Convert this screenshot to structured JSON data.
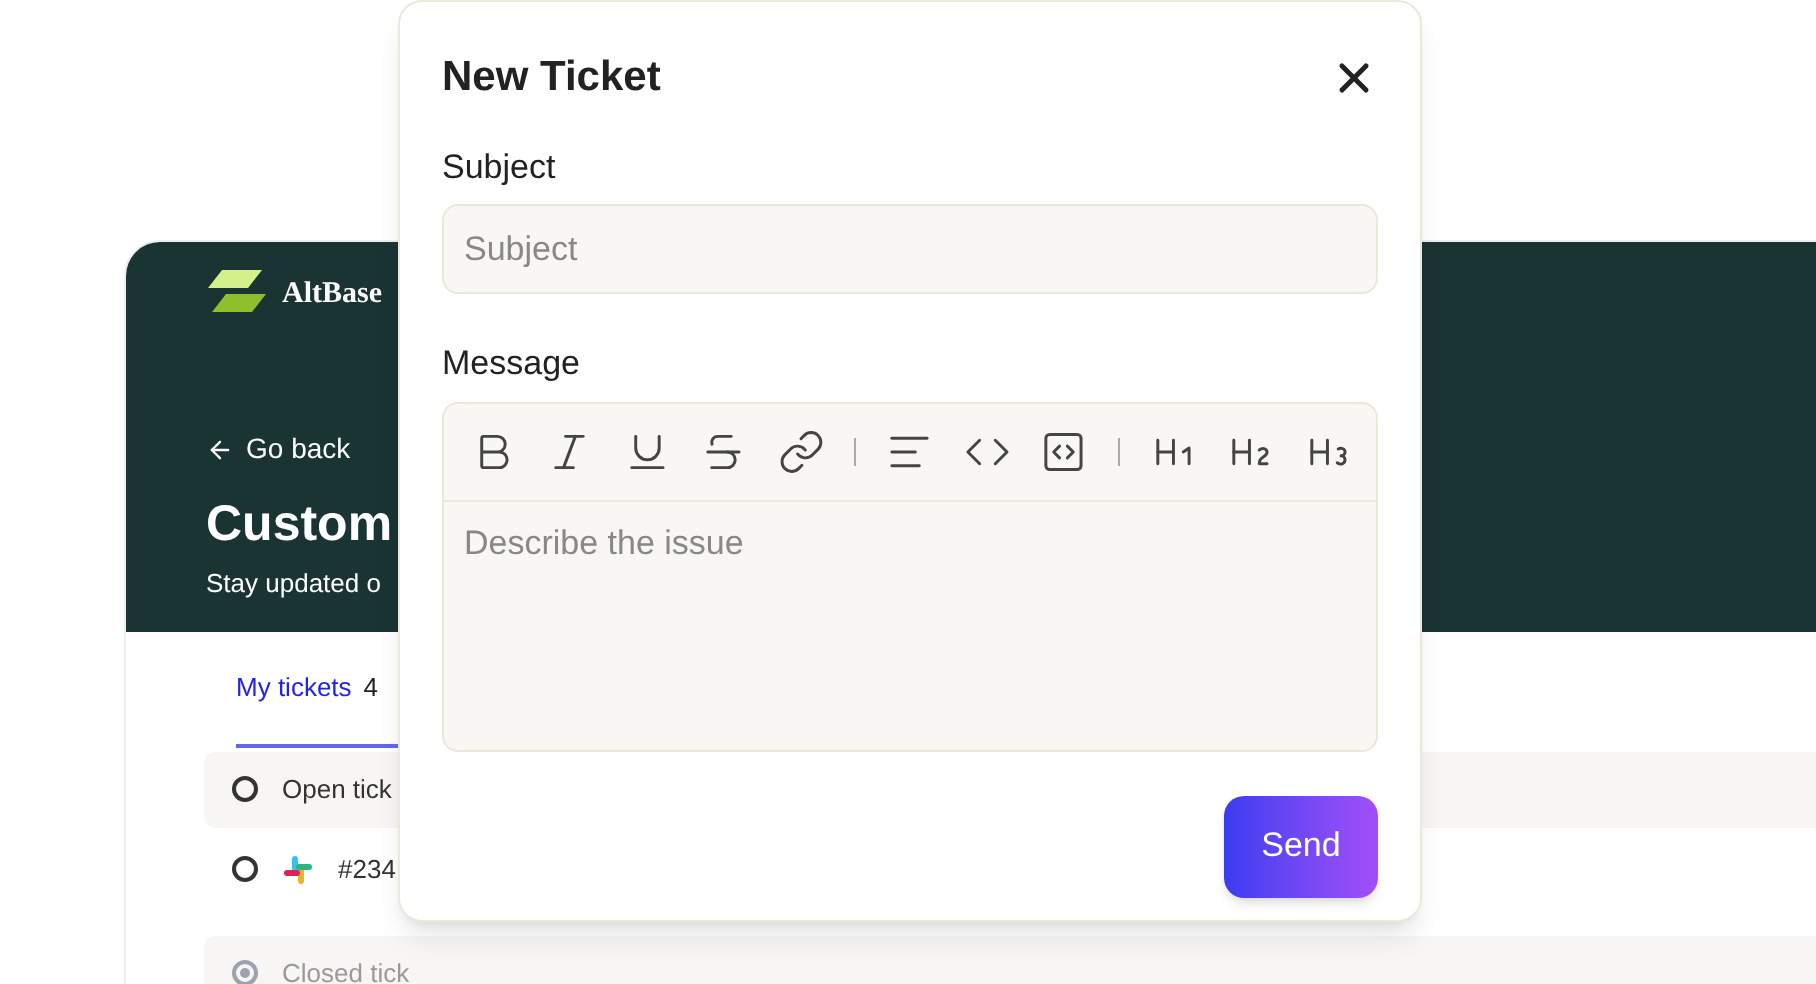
{
  "brand": {
    "name": "AltBase"
  },
  "header": {
    "back": "Go back",
    "title": "Custom",
    "subtitle": "Stay updated o"
  },
  "tabs": [
    {
      "label": "My tickets",
      "count": "4",
      "selected": true
    }
  ],
  "list": [
    {
      "kind": "group",
      "label": "Open tick",
      "selected": false
    },
    {
      "kind": "ticket",
      "label": "#234",
      "selected": false
    },
    {
      "kind": "group",
      "label": "Closed tick",
      "selected": true
    }
  ],
  "dialog": {
    "title": "New Ticket",
    "subject_label": "Subject",
    "subject_placeholder": "Subject",
    "message_label": "Message",
    "message_placeholder": "Describe the issue",
    "send": "Send"
  }
}
